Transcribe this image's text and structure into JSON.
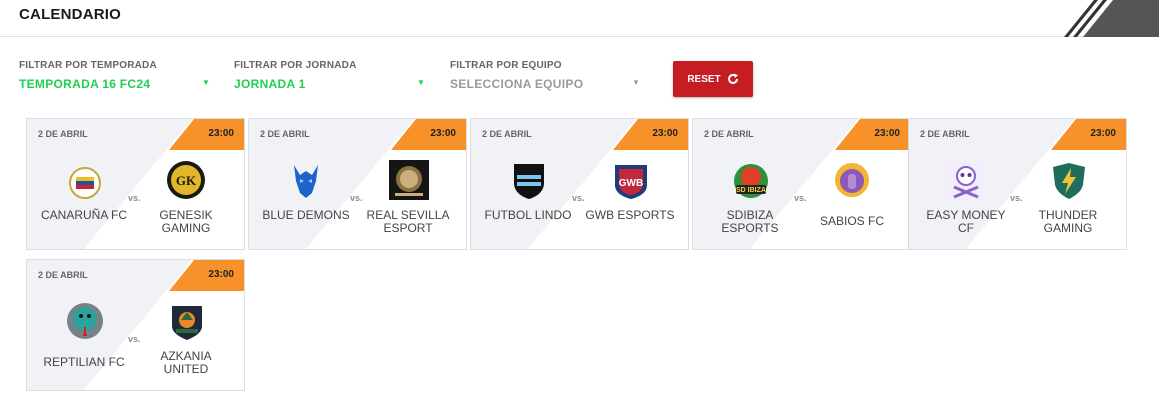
{
  "header": {
    "title": "CALENDARIO"
  },
  "filters": [
    {
      "label": "FILTRAR POR TEMPORADA",
      "value": "TEMPORADA 16 FC24",
      "active": true
    },
    {
      "label": "FILTRAR POR JORNADA",
      "value": "JORNADA 1",
      "active": true
    },
    {
      "label": "FILTRAR POR EQUIPO",
      "value": "SELECCIONA EQUIPO",
      "active": false
    }
  ],
  "reset": {
    "label": "RESET",
    "icon": "refresh-icon"
  },
  "vs_label": "vs.",
  "colors": {
    "accent_green": "#1fcf4f",
    "reset_red": "#c61d23",
    "time_orange": "#f7922a"
  },
  "matches": [
    {
      "date": "2 DE ABRIL",
      "time": "23:00",
      "home": {
        "name": "CANARUÑA FC",
        "icon": "canaruna-crest-icon"
      },
      "away": {
        "name": "GENESIK GAMING",
        "icon": "genesik-crest-icon"
      }
    },
    {
      "date": "2 DE ABRIL",
      "time": "23:00",
      "home": {
        "name": "BLUE DEMONS",
        "icon": "blue-demons-crest-icon"
      },
      "away": {
        "name": "REAL SEVILLA ESPORT",
        "icon": "real-sevilla-crest-icon"
      }
    },
    {
      "date": "2 DE ABRIL",
      "time": "23:00",
      "home": {
        "name": "FUTBOL LINDO",
        "icon": "futbol-lindo-crest-icon"
      },
      "away": {
        "name": "GWB ESPORTS",
        "icon": "gwb-crest-icon"
      }
    },
    {
      "date": "2 DE ABRIL",
      "time": "23:00",
      "home": {
        "name": "SDIBIZA ESPORTS",
        "icon": "sdibiza-crest-icon"
      },
      "away": {
        "name": "SABIOS FC",
        "icon": "sabios-crest-icon"
      }
    },
    {
      "date": "2 DE ABRIL",
      "time": "23:00",
      "home": {
        "name": "EASY MONEY CF",
        "icon": "easy-money-crest-icon"
      },
      "away": {
        "name": "THUNDER GAMING",
        "icon": "thunder-crest-icon"
      }
    },
    {
      "date": "2 DE ABRIL",
      "time": "23:00",
      "home": {
        "name": "REPTILIAN FC",
        "icon": "reptilian-crest-icon"
      },
      "away": {
        "name": "AZKANIA UNITED",
        "icon": "azkania-crest-icon"
      }
    }
  ]
}
